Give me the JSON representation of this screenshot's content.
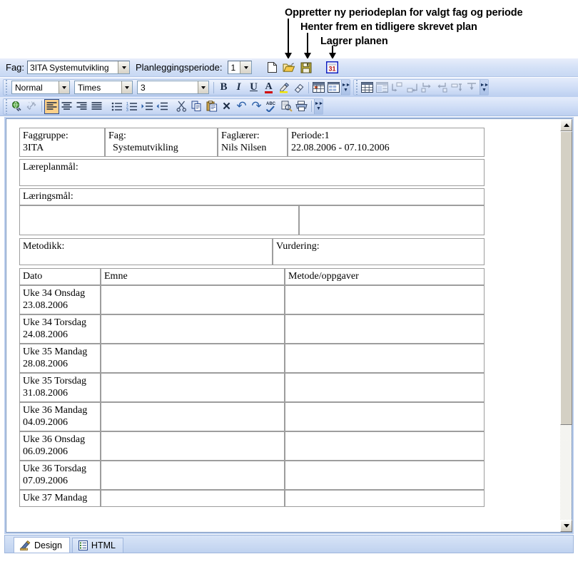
{
  "annotations": [
    {
      "id": "a1",
      "text": "Oppretter ny periodeplan for valgt fag og periode"
    },
    {
      "id": "a2",
      "text": "Henter frem en tidligere skrevet plan"
    },
    {
      "id": "a3",
      "text": "Lagrer planen"
    }
  ],
  "topbar": {
    "fag_label": "Fag:",
    "fag_value": "3ITA Systemutvikling",
    "periode_label": "Planleggingsperiode:",
    "periode_value": "1",
    "buttons": [
      {
        "name": "new-document-button",
        "icon": "new-document-icon"
      },
      {
        "name": "open-document-button",
        "icon": "open-folder-icon"
      },
      {
        "name": "save-document-button",
        "icon": "floppy-save-icon"
      },
      {
        "name": "calendar-button",
        "icon": "calendar-icon",
        "glyph": "31"
      }
    ]
  },
  "format_toolbar": {
    "style_value": "Normal",
    "font_value": "Times",
    "size_value": "3",
    "buttons": [
      {
        "name": "bold-button",
        "icon": "bold-icon",
        "glyph": "B"
      },
      {
        "name": "italic-button",
        "icon": "italic-icon",
        "glyph": "I"
      },
      {
        "name": "underline-button",
        "icon": "underline-icon",
        "glyph": "U"
      },
      {
        "name": "font-color-button",
        "icon": "font-color-icon",
        "glyph": "A"
      },
      {
        "name": "highlight-button",
        "icon": "highlight-marker-icon",
        "glyph": "✎"
      },
      {
        "name": "clear-format-button",
        "icon": "eraser-icon",
        "glyph": "⌀"
      }
    ],
    "table_buttons": [
      {
        "name": "insert-table-button",
        "icon": "insert-table-icon"
      },
      {
        "name": "table-properties-button",
        "icon": "table-grid-icon"
      }
    ]
  },
  "table_toolbar": {
    "buttons": [
      {
        "name": "insert-table-button",
        "icon": "table-icon",
        "disabled": false
      },
      {
        "name": "merge-cells-button",
        "icon": "merge-cells-icon",
        "disabled": true
      },
      {
        "name": "insert-row-above-button",
        "icon": "insert-row-above-icon",
        "disabled": true
      },
      {
        "name": "insert-row-below-button",
        "icon": "insert-row-below-icon",
        "disabled": true
      },
      {
        "name": "insert-column-left-button",
        "icon": "insert-column-left-icon",
        "disabled": true
      },
      {
        "name": "insert-column-right-button",
        "icon": "insert-column-right-icon",
        "disabled": true
      },
      {
        "name": "delete-row-button",
        "icon": "delete-row-icon",
        "disabled": true
      },
      {
        "name": "delete-column-button",
        "icon": "delete-column-icon",
        "disabled": true
      }
    ]
  },
  "edit_toolbar": {
    "buttons": [
      {
        "name": "insert-hyperlink-button",
        "icon": "hyperlink-globe-icon",
        "disabled": false
      },
      {
        "name": "remove-hyperlink-button",
        "icon": "unlink-icon",
        "disabled": true
      },
      {
        "name": "align-left-button",
        "icon": "align-left-icon",
        "selected": true
      },
      {
        "name": "align-center-button",
        "icon": "align-center-icon"
      },
      {
        "name": "align-right-button",
        "icon": "align-right-icon"
      },
      {
        "name": "align-justify-button",
        "icon": "align-justify-icon"
      },
      {
        "name": "bullet-list-button",
        "icon": "bullet-list-icon"
      },
      {
        "name": "numbered-list-button",
        "icon": "numbered-list-icon"
      },
      {
        "name": "indent-increase-button",
        "icon": "indent-increase-icon"
      },
      {
        "name": "indent-decrease-button",
        "icon": "indent-decrease-icon"
      },
      {
        "name": "cut-button",
        "icon": "scissors-icon"
      },
      {
        "name": "copy-button",
        "icon": "copy-icon"
      },
      {
        "name": "paste-button",
        "icon": "paste-clipboard-icon"
      },
      {
        "name": "delete-button",
        "icon": "delete-x-icon",
        "glyph": "✕"
      },
      {
        "name": "undo-button",
        "icon": "undo-arrow-icon",
        "glyph": "↶"
      },
      {
        "name": "redo-button",
        "icon": "redo-arrow-icon",
        "glyph": "↷"
      },
      {
        "name": "spellcheck-button",
        "icon": "spellcheck-abc-icon"
      },
      {
        "name": "print-preview-button",
        "icon": "print-preview-icon"
      },
      {
        "name": "print-button",
        "icon": "printer-icon"
      }
    ]
  },
  "document": {
    "header_row": [
      {
        "label": "Faggruppe:",
        "value": "3ITA"
      },
      {
        "label": "Fag:",
        "value": "Systemutvikling"
      },
      {
        "label": "Faglærer:",
        "value": "Nils Nilsen"
      },
      {
        "label": "Periode:1",
        "value": "22.08.2006 - 07.10.2006"
      }
    ],
    "laereplanmal_label": "Læreplanmål:",
    "laeringsmal_label": "Læringsmål:",
    "metodikk_label": "Metodikk:",
    "vurdering_label": "Vurdering:",
    "plan_headers": [
      "Dato",
      "Emne",
      "Metode/oppgaver"
    ],
    "plan_rows": [
      {
        "dato_line1": "Uke 34 Onsdag",
        "dato_line2": "23.08.2006",
        "emne": "",
        "metode": ""
      },
      {
        "dato_line1": "Uke 34 Torsdag",
        "dato_line2": "24.08.2006",
        "emne": "",
        "metode": ""
      },
      {
        "dato_line1": "Uke 35 Mandag",
        "dato_line2": "28.08.2006",
        "emne": "",
        "metode": ""
      },
      {
        "dato_line1": "Uke 35 Torsdag",
        "dato_line2": "31.08.2006",
        "emne": "",
        "metode": ""
      },
      {
        "dato_line1": "Uke 36 Mandag",
        "dato_line2": "04.09.2006",
        "emne": "",
        "metode": ""
      },
      {
        "dato_line1": "Uke 36 Onsdag",
        "dato_line2": "06.09.2006",
        "emne": "",
        "metode": ""
      },
      {
        "dato_line1": "Uke 36 Torsdag",
        "dato_line2": "07.09.2006",
        "emne": "",
        "metode": ""
      },
      {
        "dato_line1": "Uke 37 Mandag",
        "dato_line2": "",
        "emne": "",
        "metode": ""
      }
    ]
  },
  "bottom_tabs": [
    {
      "label": "Design",
      "icon": "design-pencil-ruler-icon",
      "active": true
    },
    {
      "label": "HTML",
      "icon": "html-document-icon",
      "active": false
    }
  ],
  "colors": {
    "toolbar_blue": "#cfddf6",
    "selected_orange": "#fcd08a",
    "tab_bar": "#c3d5f0",
    "accent_border": "#7a95bd"
  }
}
